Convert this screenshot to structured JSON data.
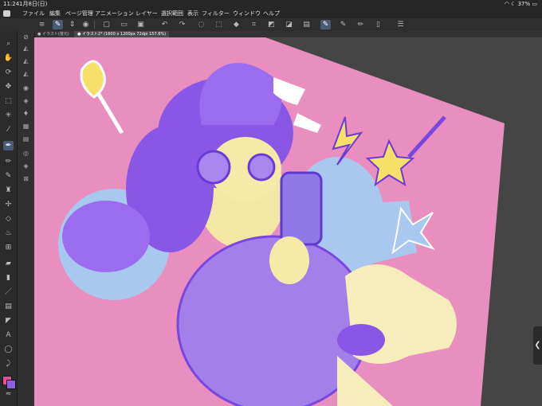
{
  "status": {
    "time": "11:24",
    "date": "1月8日(日)",
    "battery": "37%"
  },
  "menu": [
    "ファイル",
    "編集",
    "ページ管理",
    "アニメーション",
    "レイヤー",
    "選択範囲",
    "表示",
    "フィルター",
    "ウィンドウ",
    "ヘルプ"
  ],
  "tabs": [
    {
      "label": "● イラスト(復元)"
    },
    {
      "label": "● イラスト2* (1600 x 1200px 72dpi 157.6%)"
    }
  ],
  "colors": {
    "main": "#e64d9a",
    "sub": "#8e5ee0"
  },
  "icons": {
    "commands": [
      "menu-icon",
      "pen-tool-icon",
      "stepper-icon",
      "camera-icon",
      "new-file-icon",
      "open-folder-icon",
      "save-icon",
      "undo-icon",
      "redo-icon",
      "lasso-icon",
      "transform-icon",
      "fill-icon",
      "crop-icon",
      "layer-a-icon",
      "layer-b-icon",
      "layer-c-icon",
      "brush-mode-icon",
      "brush-mode-2-icon",
      "brush-mode-3-icon",
      "phone-icon",
      "list-icon"
    ],
    "tools": [
      "zoom-icon",
      "hand-icon",
      "rotate-icon",
      "move-icon",
      "select-rect-icon",
      "lasso-select-icon",
      "eyedropper-icon",
      "pen-icon",
      "pencil-icon",
      "brush-icon",
      "airbrush-icon",
      "decoration-icon",
      "eraser-icon",
      "blend-icon",
      "fill-bucket-icon",
      "gradient-icon",
      "figure-icon",
      "frame-icon",
      "ruler-icon",
      "text-icon",
      "balloon-icon",
      "correction-icon"
    ]
  }
}
